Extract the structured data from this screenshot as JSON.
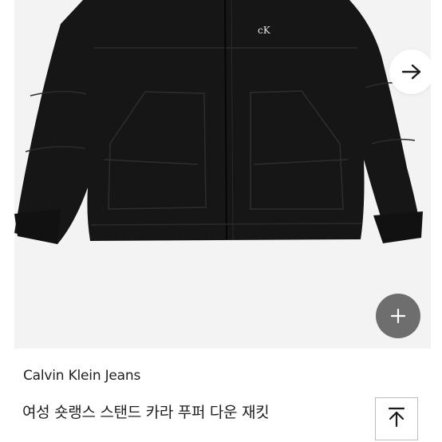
{
  "product": {
    "brand": "Calvin Klein Jeans",
    "name": "여성 숏랭스 스탠드 카라 푸퍼 다운 재킷",
    "logo_text": "cK"
  },
  "controls": {
    "next_icon": "arrow-right-icon",
    "add_icon": "plus-icon",
    "scroll_top_icon": "arrow-up-to-top-icon"
  },
  "colors": {
    "image_background": "#f3f3f3",
    "jacket": "#161616",
    "add_button": "#6e6e6e"
  }
}
